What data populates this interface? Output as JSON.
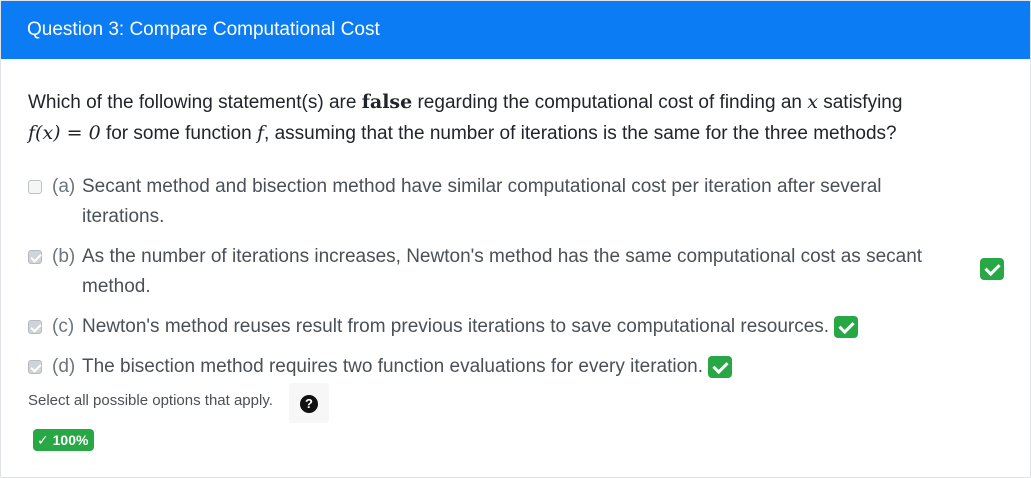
{
  "header": {
    "title": "Question 3: Compare Computational Cost"
  },
  "question": {
    "text_1": "Which of the following statement(s) are ",
    "bold_word": "false",
    "text_2": " regarding the computational cost of finding an ",
    "var_x": "x",
    "text_3": " satisfying",
    "equation": "f(x) = 0",
    "text_4": " for some function ",
    "var_f": "f",
    "text_5": ", assuming that the number of iterations is the same for the three methods?"
  },
  "options": [
    {
      "key": "(a)",
      "line1": "Secant method and bisection method have similar computational cost per iteration after several",
      "line2": "iterations.",
      "checked": false,
      "correct_badge": false
    },
    {
      "key": "(b)",
      "line1": "As the number of iterations increases, Newton's method has the same computational cost as secant",
      "line2": "method.",
      "checked": true,
      "correct_badge": true
    },
    {
      "key": "(c)",
      "text": "Newton's method reuses result from previous iterations to save computational resources.",
      "checked": true,
      "correct_badge": true
    },
    {
      "key": "(d)",
      "text": "The bisection method requires two function evaluations for every iteration.",
      "checked": true,
      "correct_badge": true
    }
  ],
  "footer": {
    "hint": "Select all possible options that apply.",
    "help_icon": "?",
    "score": "100%",
    "score_icon": "✓"
  },
  "colors": {
    "header_bg": "#0b7cf3",
    "success": "#28a745"
  }
}
